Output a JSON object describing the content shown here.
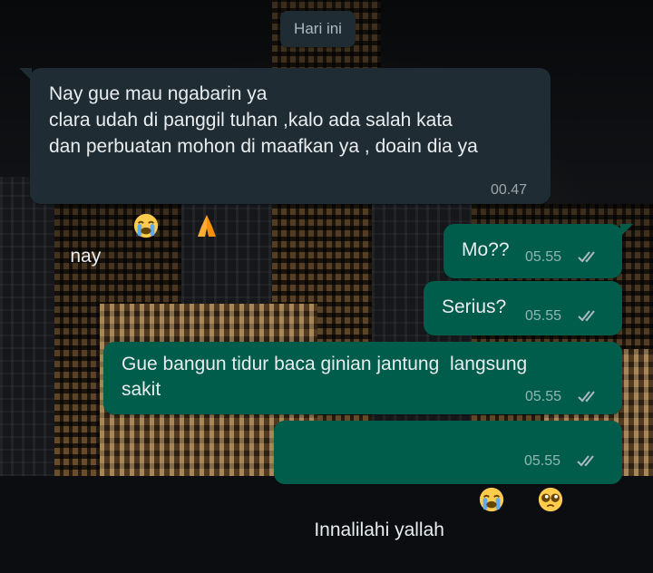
{
  "chat": {
    "date_separator": "Hari ini",
    "messages": [
      {
        "direction": "incoming",
        "lines": [
          "Nay gue mau ngabarin ya",
          "clara udah di panggil tuhan ,kalo ada salah kata",
          "dan perbuatan mohon di maafkan ya , doain dia ya",
          "nay"
        ],
        "emojis": [
          "loudly-crying-face",
          "folded-hands"
        ],
        "time": "00.47"
      },
      {
        "direction": "outgoing",
        "text": "Mo??",
        "time": "05.55",
        "status": "read"
      },
      {
        "direction": "outgoing",
        "text": "Serius?",
        "time": "05.55",
        "status": "read"
      },
      {
        "direction": "outgoing",
        "lines": [
          "Gue bangun tidur baca ginian jantung  langsung",
          "sakit"
        ],
        "time": "05.55",
        "status": "read"
      },
      {
        "direction": "outgoing",
        "text": "Innalilahi yallah",
        "emojis": [
          "loudly-crying-face",
          "pleading-face"
        ],
        "time": "05.55",
        "status": "read"
      }
    ]
  },
  "colors": {
    "incoming_bubble": "#1f2c34",
    "outgoing_bubble": "#005c4b",
    "text": "#e9edef",
    "meta_text": "#aebac1",
    "read_ticks": "#aebac1"
  }
}
